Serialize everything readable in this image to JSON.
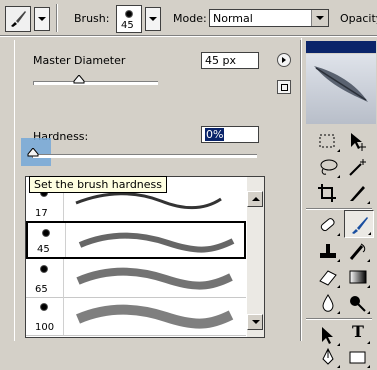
{
  "options_bar": {
    "brush_label": "Brush:",
    "brush_size": "45",
    "mode_label": "Mode:",
    "mode_value": "Normal",
    "opacity_label": "Opacity:"
  },
  "brush_panel": {
    "master_diameter_label": "Master Diameter",
    "master_diameter_value": "45 px",
    "hardness_label": "Hardness:",
    "hardness_value": "0%",
    "tooltip": "Set the brush hardness",
    "brushes": [
      {
        "size": "17"
      },
      {
        "size": "45"
      },
      {
        "size": "65"
      },
      {
        "size": "100"
      }
    ]
  },
  "toolbox": {
    "type_tool_glyph": "T",
    "colors": {
      "header": "#0a246a",
      "highlight": "#74a8d8",
      "selection": "#0a246a"
    }
  }
}
